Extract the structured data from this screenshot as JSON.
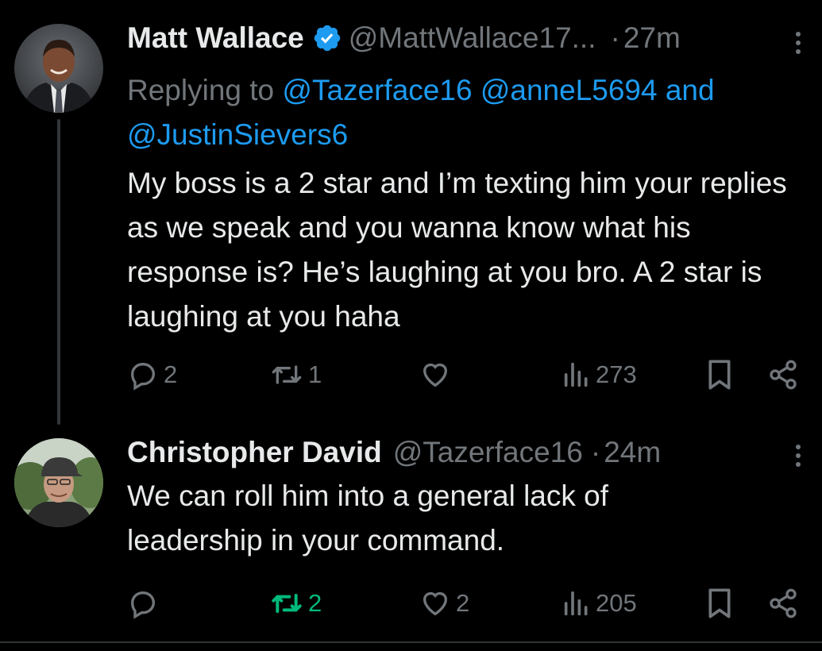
{
  "tweets": [
    {
      "name": "Matt Wallace",
      "handle": "@MattWallace17...",
      "separator": "·",
      "time": "27m",
      "replying_prefix": "Replying to",
      "mentions": [
        "@Tazerface16",
        "@anneL5694",
        "and",
        "@JustinSievers6"
      ],
      "text": "My boss is a 2 star and I’m texting him your replies as we speak and you wanna know what his response is? He’s laughing at you bro. A 2 star is laughing at you haha",
      "replies": "2",
      "reposts": "1",
      "likes": "",
      "views": "273",
      "verified": true,
      "colors": {
        "verified": "#1d9bf0"
      }
    },
    {
      "name": "Christopher David",
      "handle": "@Tazerface16",
      "separator": "·",
      "time": "24m",
      "text": "We can roll him into a general lack of leadership in your command.",
      "replies": "",
      "reposts": "2",
      "likes": "2",
      "views": "205",
      "reposted_by_viewer": true,
      "colors": {
        "repost_active": "#00ba7c"
      }
    }
  ],
  "icons": [
    "reply-icon",
    "repost-icon",
    "like-icon",
    "views-icon",
    "bookmark-icon",
    "share-icon",
    "more-icon",
    "verified-icon"
  ]
}
